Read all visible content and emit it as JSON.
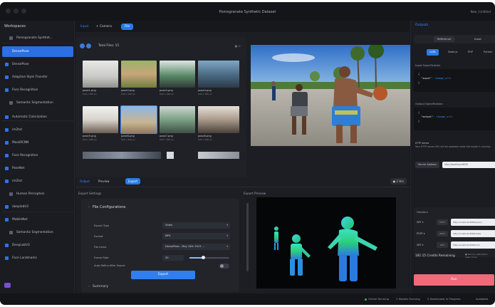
{
  "window": {
    "title": "Pomegranate Synthetic Dataset",
    "right_label": "New | Untitled"
  },
  "sidebar": {
    "header": "Workspaces",
    "items": [
      {
        "label": "Pomegranate Synthet...",
        "type": "sub"
      },
      {
        "label": "DensePose",
        "type": "active"
      },
      {
        "label": "DensePose",
        "type": "item"
      },
      {
        "label": "Adaptive Style Transfer",
        "type": "item"
      },
      {
        "label": "Face Recognition",
        "type": "item"
      },
      {
        "label": "Semantic Segmentation",
        "type": "sub"
      },
      {
        "label": "Automatic Colorization",
        "type": "item"
      },
      {
        "label": "im2txt",
        "type": "item"
      },
      {
        "label": "MaskRCNN",
        "type": "item"
      },
      {
        "label": "Face Recognition",
        "type": "item"
      },
      {
        "label": "PoseNet",
        "type": "item"
      },
      {
        "label": "im2txt",
        "type": "item"
      },
      {
        "label": "Human Perception",
        "type": "sub"
      },
      {
        "label": "deeplabV3",
        "type": "item"
      },
      {
        "label": "MobileNet",
        "type": "item"
      },
      {
        "label": "Semantic Segmentation",
        "type": "sub"
      },
      {
        "label": "DeepLabV3",
        "type": "item"
      },
      {
        "label": "Face Landmarks",
        "type": "item"
      }
    ]
  },
  "main": {
    "tabs": [
      {
        "label": "Input",
        "style": "blue"
      },
      {
        "label": "+ Camera",
        "style": "plain"
      },
      {
        "label": "File",
        "style": "active"
      }
    ],
    "gallery": {
      "total_files": "Total Files: 15",
      "icons": "▦ ≡",
      "thumbs": [
        {
          "name": "pose1.png",
          "size": "640 x 480 px"
        },
        {
          "name": "pose2.png",
          "size": "640 x 480 px"
        },
        {
          "name": "pose3.png",
          "size": "640 x 480 px"
        },
        {
          "name": "pose4.png",
          "size": "640 x 480 px"
        },
        {
          "name": "pose5.png",
          "size": "640 x 480 px"
        },
        {
          "name": "pose6.png",
          "size": "640 x 480 px"
        },
        {
          "name": "pose7.png",
          "size": "640 x 480 px"
        },
        {
          "name": "pose8.png",
          "size": "640 x 480 px"
        }
      ]
    },
    "subtabs": [
      {
        "label": "Output",
        "style": "blue"
      },
      {
        "label": "Preview",
        "style": "plain"
      },
      {
        "label": "Export",
        "style": "active"
      }
    ],
    "status_pill": "● 2 Hrs",
    "settings": {
      "section_label": "Export Settings",
      "card_title": "File Configurations",
      "rows": [
        {
          "label": "Export Type",
          "value": "Video"
        },
        {
          "label": "Format",
          "value": "MP4"
        },
        {
          "label": "File name",
          "value": "DensePose - May 24th 2019 ..."
        },
        {
          "label": "Frame Rate",
          "value": "30"
        },
        {
          "label": "Auto Refine After Export",
          "value": ""
        }
      ],
      "frame_rate_level": 0.35,
      "export_button": "Export",
      "card_title2": "Summary"
    },
    "export_preview": {
      "label": "Export Preview"
    }
  },
  "right": {
    "header": "Outputs",
    "tabs": [
      "Reference",
      "Input"
    ],
    "pills": [
      {
        "label": "cURL",
        "active": true
      },
      {
        "label": "Node.js",
        "active": false
      },
      {
        "label": "PHP",
        "active": false
      },
      {
        "label": "Python",
        "active": false
      }
    ],
    "input_spec_label": "Input Specification",
    "input_code": {
      "open": "{",
      "key": "\"input\"",
      "val": ": <image_url>",
      "close": "}"
    },
    "output_spec_label": "Output Specification",
    "output_code": {
      "open": "{",
      "key": "\"output\"",
      "val": ": <image_url>",
      "close": "}"
    },
    "http_title": "HTTP Server",
    "http_note": "Your HTTP server URL will be available while this model is running.",
    "url_button": "Server Address",
    "url_value": "http://localhost:8000",
    "headers_label": "Headers",
    "headers": [
      {
        "key": "GET ▾",
        "sel": "POST",
        "val": "http://localhost:8000/query"
      },
      {
        "key": "POST ▾",
        "sel": "POST",
        "val": "http://localhost:8000/data"
      },
      {
        "key": "GET ▾",
        "sel": "GET",
        "val": "http://localhost:8000/info"
      }
    ],
    "credits": "181.15 Credits Remaining",
    "credits_note": "● Not run estimation · Learn more",
    "run_button": "Run"
  },
  "status": {
    "items": [
      "Online Running",
      "1 Models Running",
      "0 Downloads In Progress",
      "Available"
    ]
  },
  "colors": {
    "accent": "#2c7be5",
    "active_sidebar": "#2c6fe0",
    "run_button": "#f06a7a",
    "background": "#17191e"
  }
}
